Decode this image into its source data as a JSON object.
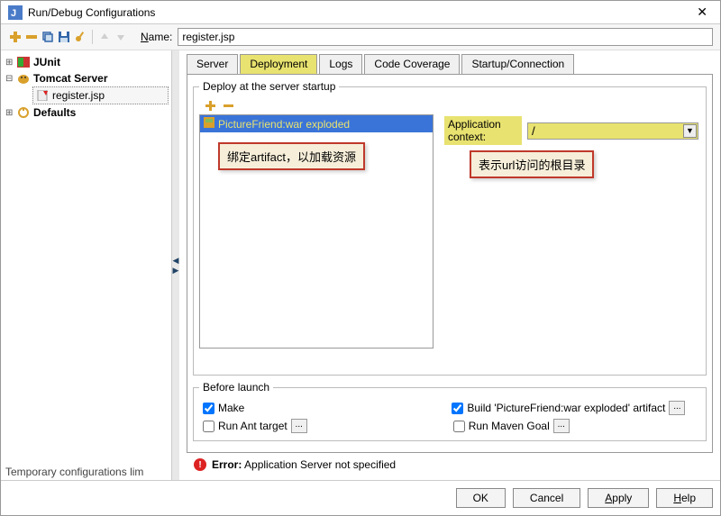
{
  "title": "Run/Debug Configurations",
  "name_label": "Name:",
  "name_value": "register.jsp",
  "tree": {
    "junit": "JUnit",
    "tomcat": "Tomcat Server",
    "register": "register.jsp",
    "defaults": "Defaults"
  },
  "tabs": {
    "server": "Server",
    "deployment": "Deployment",
    "logs": "Logs",
    "coverage": "Code Coverage",
    "startup": "Startup/Connection"
  },
  "deploy": {
    "legend": "Deploy at the server startup",
    "item": "PictureFriend:war exploded",
    "context_label": "Application context:",
    "context_value": "/"
  },
  "annotation1": "绑定artifact，以加载资源",
  "annotation2": "表示url访问的根目录",
  "before": {
    "legend": "Before launch",
    "make": "Make",
    "build": "Build 'PictureFriend:war exploded' artifact",
    "ant": "Run Ant target",
    "maven": "Run Maven Goal"
  },
  "error_label": "Error:",
  "error_msg": "Application Server not specified",
  "temp_note": "Temporary configurations lim",
  "buttons": {
    "ok": "OK",
    "cancel": "Cancel",
    "apply": "Apply",
    "help": "Help"
  },
  "underline_chars": {
    "name": "N",
    "help": "H",
    "apply": "A"
  }
}
